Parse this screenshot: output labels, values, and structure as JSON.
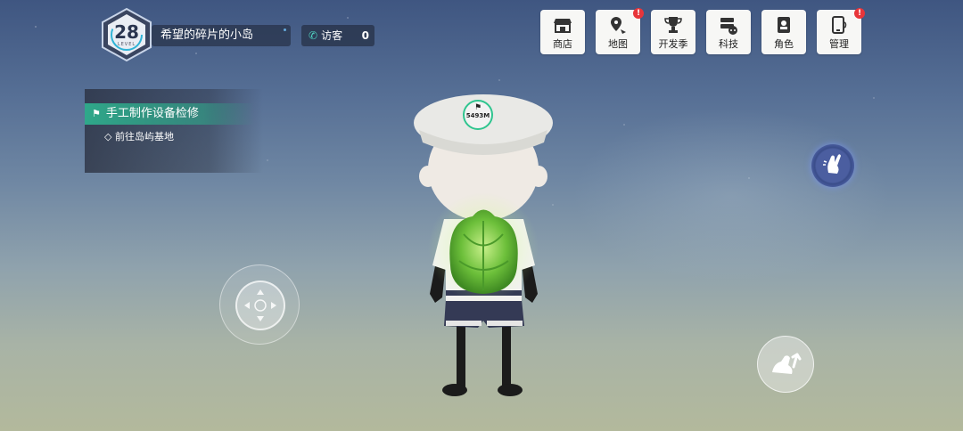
{
  "hud": {
    "level": "28",
    "level_label": "LEVEL",
    "island_name": "希望的碎片的小岛",
    "visitors_label": "访客",
    "visitors_count": "0"
  },
  "menu": [
    {
      "label": "商店",
      "icon": "shop-icon",
      "alert": false
    },
    {
      "label": "地图",
      "icon": "map-icon",
      "alert": true
    },
    {
      "label": "开发季",
      "icon": "trophy-icon",
      "alert": false
    },
    {
      "label": "科技",
      "icon": "tech-icon",
      "alert": false
    },
    {
      "label": "角色",
      "icon": "character-icon",
      "alert": false
    },
    {
      "label": "管理",
      "icon": "manage-icon",
      "alert": true
    }
  ],
  "alert_mark": "!",
  "quest": {
    "title": "手工制作设备检修",
    "subtask": "◇ 前往岛屿基地"
  },
  "waypoint": {
    "distance": "5493M"
  },
  "colors": {
    "quest_green": "#2fa88a",
    "alert_red": "#e8353a",
    "waypoint_ring": "#2fc58f"
  }
}
